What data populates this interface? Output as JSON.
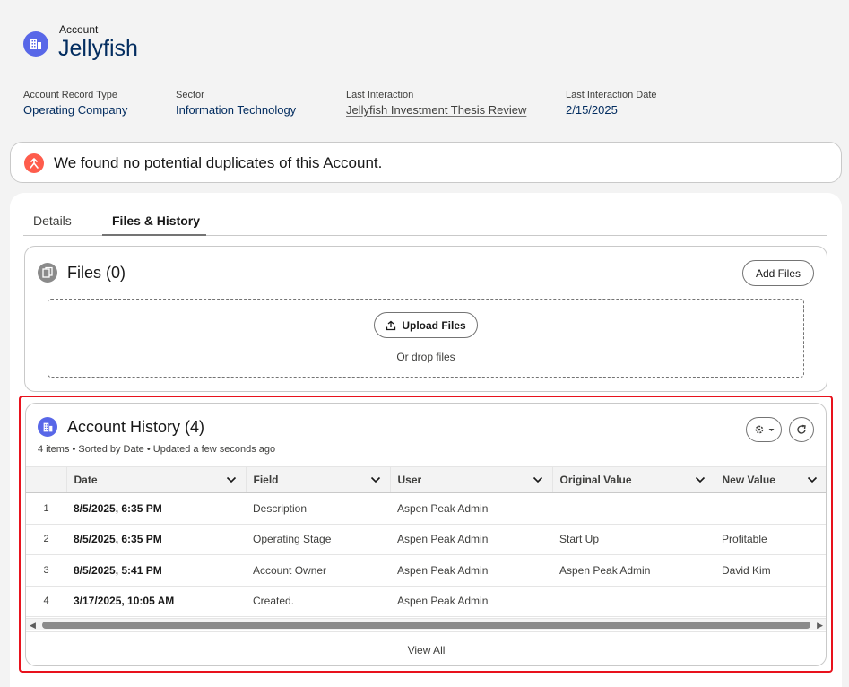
{
  "record": {
    "object_type": "Account",
    "name": "Jellyfish",
    "icon": "account-icon"
  },
  "highlights": [
    {
      "label": "Account Record Type",
      "value": "Operating Company"
    },
    {
      "label": "Sector",
      "value": "Information Technology"
    },
    {
      "label": "Last Interaction",
      "value": "Jellyfish Investment Thesis Review"
    },
    {
      "label": "Last Interaction Date",
      "value": "2/15/2025"
    }
  ],
  "duplicate_banner": {
    "icon": "duplicate-icon",
    "text": "We found no potential duplicates of this Account."
  },
  "tabs": [
    {
      "label": "Details",
      "active": false
    },
    {
      "label": "Files & History",
      "active": true
    }
  ],
  "files": {
    "title": "Files (0)",
    "add_button": "Add Files",
    "upload_button": "Upload Files",
    "drop_text": "Or drop files"
  },
  "history": {
    "title": "Account History (4)",
    "subtitle": "4 items • Sorted by Date • Updated a few seconds ago",
    "columns": [
      "Date",
      "Field",
      "User",
      "Original Value",
      "New Value"
    ],
    "rows": [
      {
        "num": "1",
        "date": "8/5/2025, 6:35 PM",
        "field": "Description",
        "user": "Aspen Peak Admin",
        "original": "",
        "new": ""
      },
      {
        "num": "2",
        "date": "8/5/2025, 6:35 PM",
        "field": "Operating Stage",
        "user": "Aspen Peak Admin",
        "original": "Start Up",
        "new": "Profitable"
      },
      {
        "num": "3",
        "date": "8/5/2025, 5:41 PM",
        "field": "Account Owner",
        "user": "Aspen Peak Admin",
        "original": "Aspen Peak Admin",
        "new": "David Kim"
      },
      {
        "num": "4",
        "date": "3/17/2025, 10:05 AM",
        "field": "Created.",
        "user": "Aspen Peak Admin",
        "original": "",
        "new": ""
      }
    ],
    "view_all": "View All"
  },
  "colors": {
    "account_icon": "#5867e8",
    "duplicate_icon": "#fe5c4c",
    "highlight_border": "#e8121d",
    "title_text": "#032d60"
  }
}
